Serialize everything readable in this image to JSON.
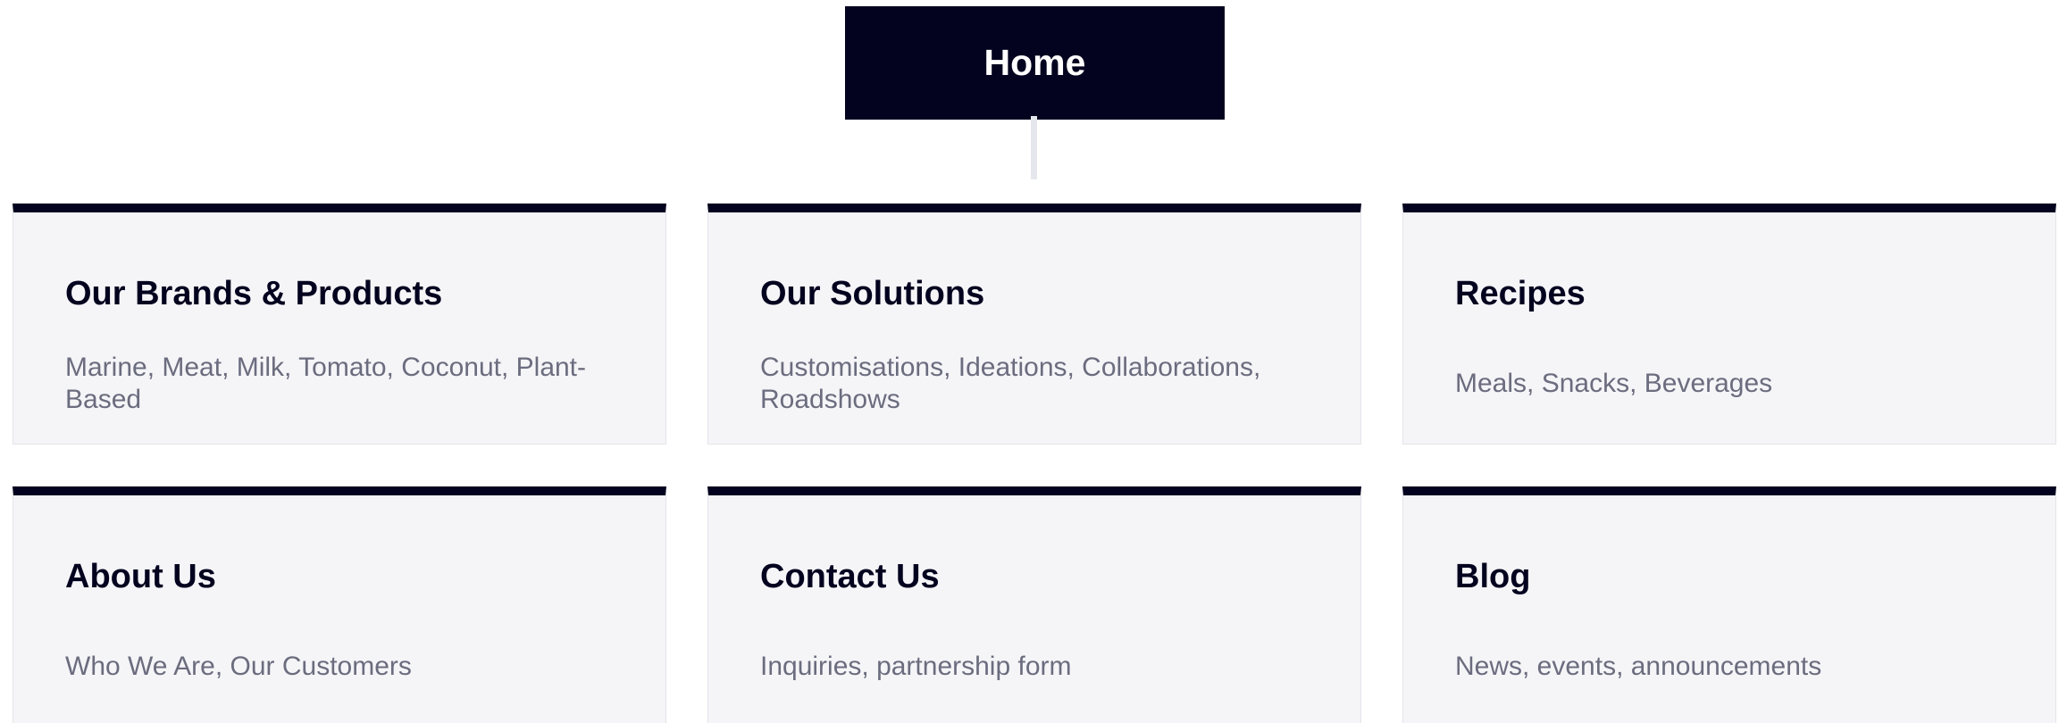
{
  "home": {
    "label": "Home"
  },
  "cards": [
    {
      "title": "Our Brands & Products",
      "description": "Marine, Meat, Milk, Tomato, Coconut, Plant-Based"
    },
    {
      "title": "Our Solutions",
      "description": "Customisations, Ideations, Collaborations, Roadshows"
    },
    {
      "title": "Recipes",
      "description": "Meals, Snacks, Beverages"
    },
    {
      "title": "About Us",
      "description": "Who We Are, Our Customers"
    },
    {
      "title": "Contact Us",
      "description": "Inquiries, partnership form"
    },
    {
      "title": "Blog",
      "description": "News, events, announcements"
    }
  ],
  "colors": {
    "navy": "#03031f",
    "card_bg": "#f5f5f8",
    "description_text": "#6b6c7e",
    "connector": "#e6e7ec"
  }
}
